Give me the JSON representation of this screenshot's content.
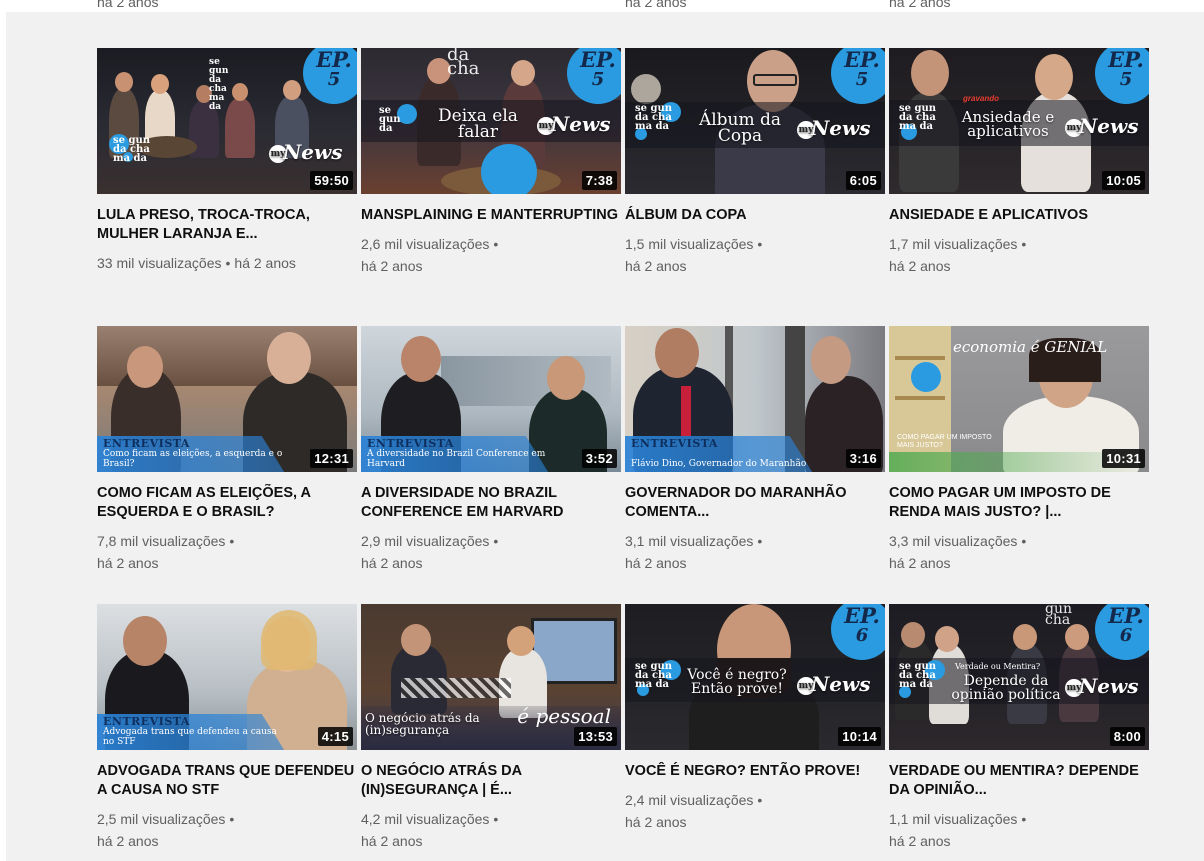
{
  "top_cut": [
    "há 2 anos",
    "há 2 anos",
    "há 2 anos"
  ],
  "videos": [
    {
      "title": "LULA PRESO, TROCA-TROCA, MULHER LARANJA E...",
      "views": "33 mil visualizações",
      "age": "há 2 anos",
      "duration": "59:50",
      "overlay": "",
      "ep": "EP.",
      "ep_n": "5",
      "thumb_brand": "News",
      "logo": "se gun da cha ma da"
    },
    {
      "title": "MANSPLAINING E MANTERRUPTING",
      "views": "2,6 mil visualizações",
      "age": "há 2 anos",
      "duration": "7:38",
      "overlay": "Deixa ela falar",
      "ep": "EP.",
      "ep_n": "5",
      "thumb_brand": "News",
      "logo": "se gun da"
    },
    {
      "title": "ÁLBUM DA COPA",
      "views": "1,5 mil visualizações",
      "age": "há 2 anos",
      "duration": "6:05",
      "overlay": "Álbum da Copa",
      "ep": "EP.",
      "ep_n": "5",
      "thumb_brand": "News",
      "logo": "se gun da cha ma da"
    },
    {
      "title": "ANSIEDADE E APLICATIVOS",
      "views": "1,7 mil visualizações",
      "age": "há 2 anos",
      "duration": "10:05",
      "overlay": "Ansiedade e aplicativos",
      "ep": "EP.",
      "ep_n": "5",
      "thumb_brand": "News",
      "logo": "se gun da cha ma da"
    },
    {
      "title": "COMO FICAM AS ELEIÇÕES, A ESQUERDA E O BRASIL?",
      "views": "7,8 mil visualizações",
      "age": "há 2 anos",
      "duration": "12:31",
      "band_label": "ENTREVISTA",
      "band_sub": "Como ficam as eleições, a esquerda e o Brasil?"
    },
    {
      "title": "A DIVERSIDADE NO BRAZIL CONFERENCE EM HARVARD",
      "views": "2,9 mil visualizações",
      "age": "há 2 anos",
      "duration": "3:52",
      "band_label": "ENTREVISTA",
      "band_sub": "A diversidade no Brazil Conference em Harvard"
    },
    {
      "title": "GOVERNADOR DO MARANHÃO COMENTA...",
      "views": "3,1 mil visualizações",
      "age": "há 2 anos",
      "duration": "3:16",
      "band_label": "ENTREVISTA",
      "band_sub": "Flávio Dino, Governador do Maranhão"
    },
    {
      "title": "COMO PAGAR UM IMPOSTO DE RENDA MAIS JUSTO? |...",
      "views": "3,3 mil visualizações",
      "age": "há 2 anos",
      "duration": "10:31",
      "econ": "economia é GENIAL",
      "econ_sub": "COMO PAGAR UM IMPOSTO MAIS JUSTO?"
    },
    {
      "title": "ADVOGADA TRANS QUE DEFENDEU A CAUSA NO STF",
      "views": "2,5 mil visualizações",
      "age": "há 2 anos",
      "duration": "4:15",
      "band_label": "ENTREVISTA",
      "band_sub": "Advogada trans que defendeu a causa no STF"
    },
    {
      "title": "O NEGÓCIO ATRÁS DA (IN)SEGURANÇA | É...",
      "views": "4,2 mil visualizações",
      "age": "há 2 anos",
      "duration": "13:53",
      "overlay": "O negócio atrás da (in)segurança",
      "pessoal": "é pessoal"
    },
    {
      "title": "VOCÊ É NEGRO? ENTÃO PROVE!",
      "views": "2,4 mil visualizações",
      "age": "há 2 anos",
      "duration": "10:14",
      "overlay": "Você é negro? Então prove!",
      "ep": "EP.",
      "ep_n": "6",
      "thumb_brand": "News",
      "logo": "se gun da cha ma da"
    },
    {
      "title": "VERDADE OU MENTIRA? DEPENDE DA OPINIÃO...",
      "views": "1,1 mil visualizações",
      "age": "há 2 anos",
      "duration": "8:00",
      "overlay": "Depende da opinião política",
      "overlay_small": "Verdade ou Mentira?",
      "ep": "EP.",
      "ep_n": "6",
      "thumb_brand": "News",
      "logo": "se gun da cha ma da"
    }
  ],
  "colors": {
    "accent_blue": "#2a9be0",
    "title": "#0f0f0f",
    "meta": "#606060",
    "background": "#f1f1f1"
  }
}
